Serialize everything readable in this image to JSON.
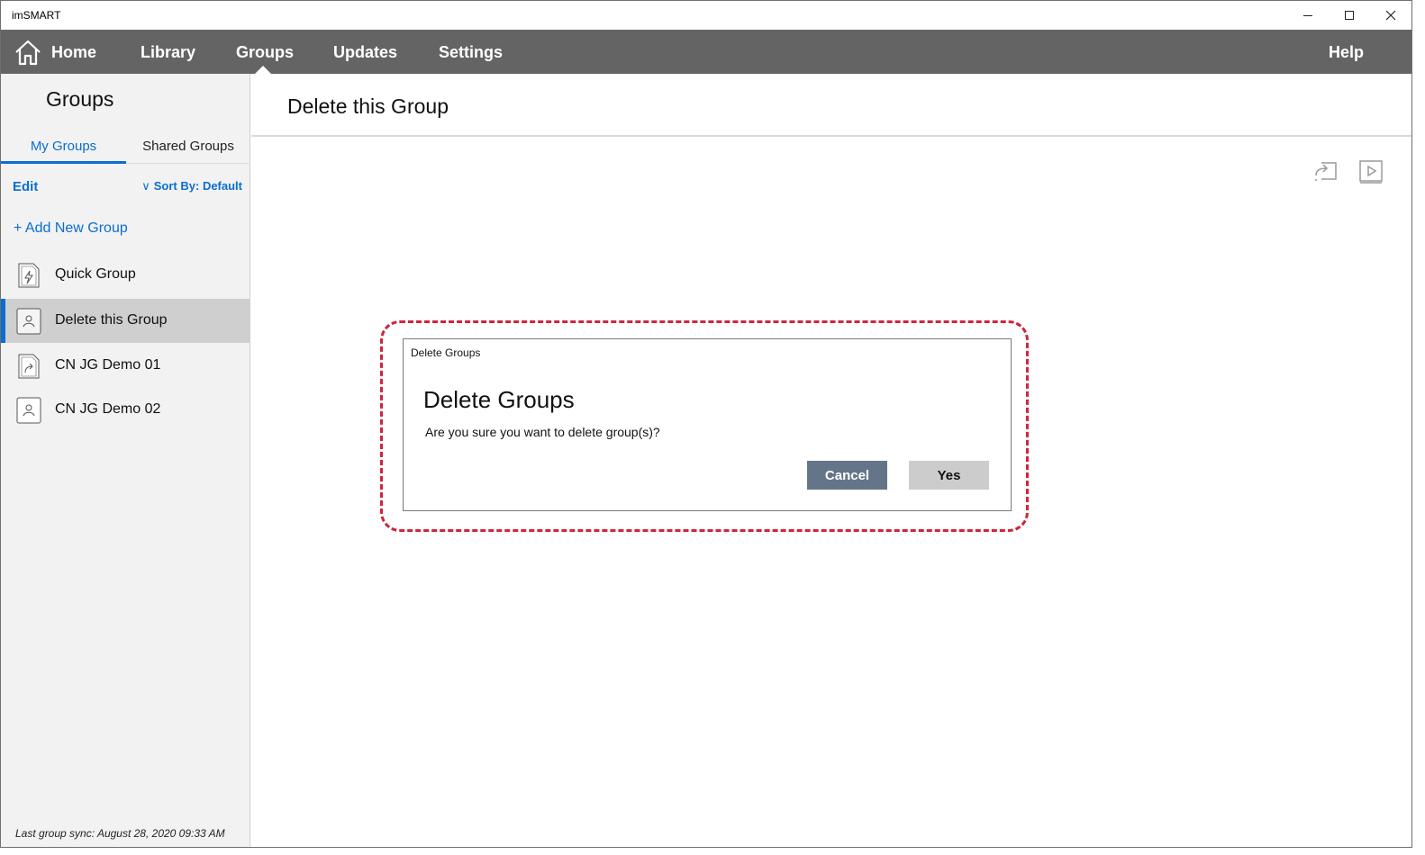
{
  "window": {
    "title": "imSMART"
  },
  "nav": {
    "home": "Home",
    "library": "Library",
    "groups": "Groups",
    "updates": "Updates",
    "settings": "Settings",
    "help": "Help",
    "active": "Groups"
  },
  "sidebar": {
    "title": "Groups",
    "tabs": {
      "mine": "My Groups",
      "shared": "Shared Groups",
      "active": "My Groups"
    },
    "edit": "Edit",
    "sort_label": "Sort By:",
    "sort_value": "Default",
    "add_group": "+ Add New Group",
    "groups": [
      {
        "label": "Quick Group",
        "icon": "quick-group-icon",
        "selected": false
      },
      {
        "label": "Delete this Group",
        "icon": "person-group-icon",
        "selected": true
      },
      {
        "label": "CN JG Demo 01",
        "icon": "shared-group-icon",
        "selected": false
      },
      {
        "label": "CN JG Demo 02",
        "icon": "person-group-icon",
        "selected": false
      }
    ],
    "last_sync": "Last group sync: August 28, 2020 09:33 AM"
  },
  "main": {
    "title": "Delete this Group",
    "tools": [
      "present-icon",
      "play-icon"
    ]
  },
  "dialog": {
    "caption": "Delete Groups",
    "heading": "Delete Groups",
    "message": "Are you sure you want to delete group(s)?",
    "cancel": "Cancel",
    "yes": "Yes"
  },
  "colors": {
    "nav_bg": "#646464",
    "accent": "#0a6ed1",
    "sidebar_bg": "#f2f2f2",
    "selected_bg": "#cfcfcf",
    "highlight": "#d0253a",
    "cancel_bg": "#647589",
    "yes_bg": "#cccccc"
  }
}
